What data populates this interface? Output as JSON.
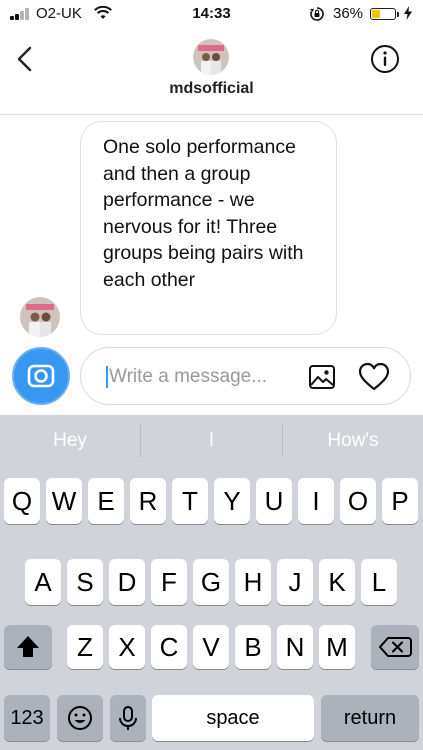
{
  "status_bar": {
    "carrier": "O2-UK",
    "time": "14:33",
    "battery_percent": "36%",
    "battery_level": 0.36,
    "battery_color": "#f5c400"
  },
  "header": {
    "back_icon": "chevron-left-icon",
    "username": "mdsofficial",
    "info_icon": "info-icon"
  },
  "conversation": {
    "messages": [
      {
        "text": "One solo performance and then a group performance - we nervous for it! Three groups being pairs with each other"
      }
    ]
  },
  "composer": {
    "placeholder": "Write a message...",
    "camera_icon": "camera-icon",
    "gallery_icon": "image-icon",
    "like_icon": "heart-icon",
    "accent_color": "#3897f0"
  },
  "keyboard": {
    "suggestions": [
      "Hey",
      "I",
      "How's"
    ],
    "row1": [
      "Q",
      "W",
      "E",
      "R",
      "T",
      "Y",
      "U",
      "I",
      "O",
      "P"
    ],
    "row2": [
      "A",
      "S",
      "D",
      "F",
      "G",
      "H",
      "J",
      "K",
      "L"
    ],
    "row3": [
      "Z",
      "X",
      "C",
      "V",
      "B",
      "N",
      "M"
    ],
    "numbers_key": "123",
    "space_key": "space",
    "return_key": "return",
    "shift_icon": "shift-icon",
    "delete_icon": "backspace-icon",
    "emoji_icon": "emoji-icon",
    "mic_icon": "microphone-icon"
  }
}
